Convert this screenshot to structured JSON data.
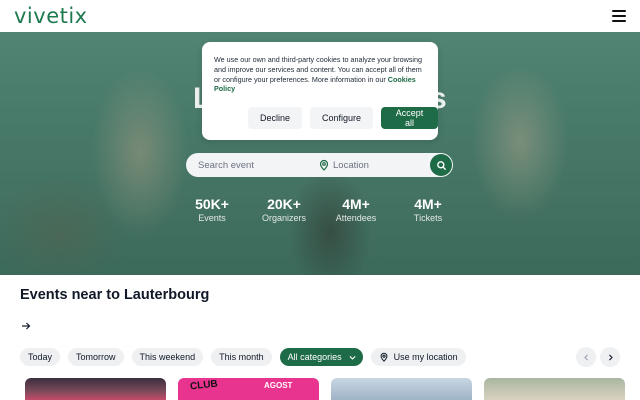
{
  "header": {
    "logo": "vivetix",
    "menu_icon": "hamburger-menu-icon"
  },
  "hero": {
    "title_left": "L",
    "title_right": "s",
    "search": {
      "placeholder": "Search event",
      "location_placeholder": "Location",
      "pin_icon": "map-pin-icon",
      "search_icon": "magnifier-icon"
    },
    "stats": [
      {
        "value": "50K+",
        "label": "Events"
      },
      {
        "value": "20K+",
        "label": "Organizers"
      },
      {
        "value": "4M+",
        "label": "Attendees"
      },
      {
        "value": "4M+",
        "label": "Tickets"
      }
    ]
  },
  "cookie_dialog": {
    "text": "We use our own and third-party cookies to analyze your browsing and improve our services and content. You can accept all of them or configure your preferences. More information in our ",
    "link": "Cookies Policy",
    "decline": "Decline",
    "configure": "Configure",
    "accept": "Accept all"
  },
  "events": {
    "title": "Events near to Lauterbourg",
    "arrow_icon": "arrow-right-icon",
    "filters": [
      "Today",
      "Tomorrow",
      "This weekend",
      "This month"
    ],
    "categories_label": "All categories",
    "location_label": "Use my location",
    "card_texts": {
      "card2_a": "CLUB",
      "card2_b": "AGOST"
    }
  },
  "colors": {
    "brand_green": "#1e6b47",
    "logo_green": "#1e7a4f",
    "chip_bg": "#eef0f2"
  }
}
